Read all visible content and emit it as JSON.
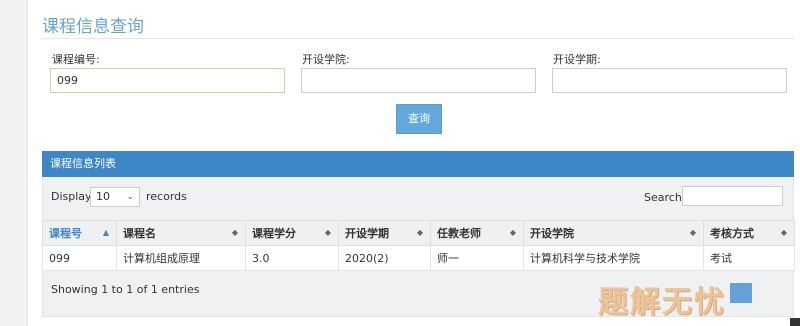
{
  "page": {
    "title": "课程信息查询"
  },
  "form": {
    "course_no": {
      "label": "课程编号:",
      "value": "099"
    },
    "college": {
      "label": "开设学院:",
      "value": ""
    },
    "semester": {
      "label": "开设学期:",
      "value": ""
    },
    "query_label": "查询"
  },
  "panel": {
    "title": "课程信息列表"
  },
  "table_controls": {
    "display_label": "Display",
    "length_value": "10",
    "records_label": "records",
    "search_label": "Search:",
    "search_value": ""
  },
  "table": {
    "headers": [
      "课程号",
      "课程名",
      "课程学分",
      "开设学期",
      "任教老师",
      "开设学院",
      "考核方式"
    ],
    "sorted_column": 0,
    "rows": [
      [
        "099",
        "计算机组成原理",
        "3.0",
        "2020(2)",
        "师一",
        "计算机科学与技术学院",
        "考试"
      ]
    ]
  },
  "footer": {
    "info": "Showing 1 to 1 of 1 entries"
  },
  "watermark": "题解无忧",
  "colors": {
    "title": "#6aa3c9",
    "panel_header": "#3d87c9",
    "button": "#64a9dc",
    "sorted_header": "#3d87c9"
  },
  "icons": {
    "sort_active": "sort-asc-icon",
    "sort_both": "sort-both-icon",
    "select_chevron": "chevron-down-icon"
  }
}
